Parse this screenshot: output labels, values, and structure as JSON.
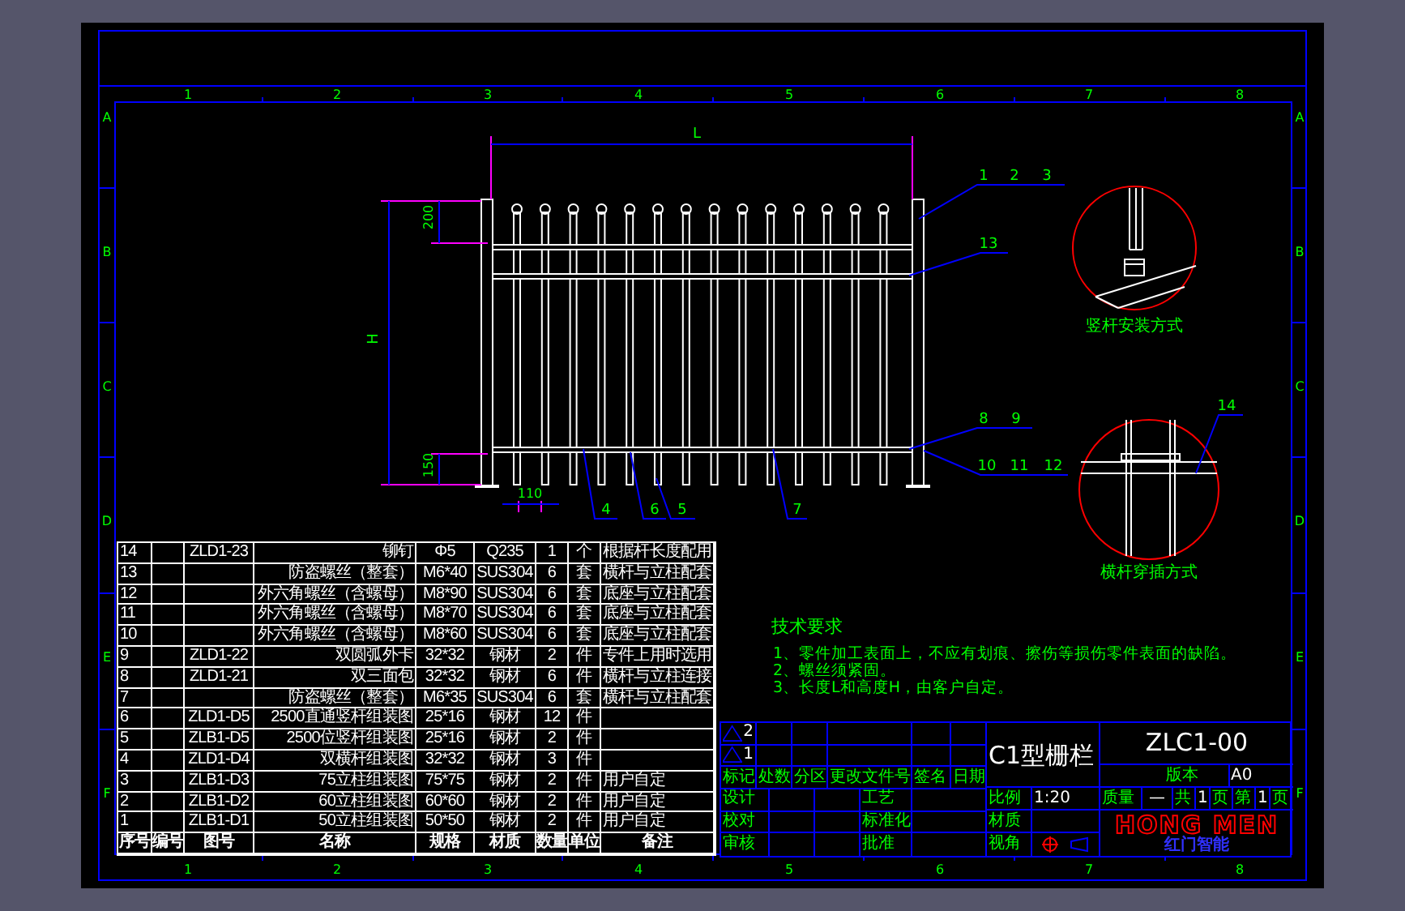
{
  "sheet": {
    "top_ruler": [
      "1",
      "2",
      "3",
      "4",
      "5",
      "6",
      "7",
      "8"
    ],
    "bottom_ruler": [
      "1",
      "2",
      "3",
      "4",
      "5",
      "6",
      "7",
      "8"
    ],
    "left_ruler": [
      "A",
      "B",
      "C",
      "D",
      "E",
      "F"
    ],
    "right_ruler": [
      "A",
      "B",
      "C",
      "D",
      "E",
      "F"
    ]
  },
  "drawing": {
    "dimensions": {
      "length": "L",
      "height": "H",
      "top_gap": "200",
      "bottom_gap": "150",
      "picket_spacing": "110"
    },
    "callouts": [
      {
        "labels": [
          "1",
          "2",
          "3"
        ]
      },
      {
        "labels": [
          "13"
        ]
      },
      {
        "labels": [
          "8",
          "9"
        ]
      },
      {
        "labels": [
          "10",
          "11",
          "12"
        ]
      },
      {
        "labels": [
          "4"
        ]
      },
      {
        "labels": [
          "6"
        ]
      },
      {
        "labels": [
          "5"
        ]
      },
      {
        "labels": [
          "7"
        ]
      }
    ],
    "details": [
      {
        "kind": "post",
        "caption": "竖杆安装方式"
      },
      {
        "kind": "rail",
        "caption": "横杆穿插方式",
        "callout": "14"
      }
    ]
  },
  "requirements": {
    "title": "技术要求",
    "items": [
      "1、零件加工表面上，不应有划痕、擦伤等损伤零件表面的缺陷。",
      "2、螺丝须紧固。",
      "3、长度L和高度H，由客户自定。"
    ]
  },
  "bom": {
    "rows": [
      [
        "14",
        "",
        "ZLD1-23",
        "铆钉",
        "Φ5",
        "Q235",
        "1",
        "个",
        "根据杆长度配用"
      ],
      [
        "13",
        "",
        "",
        "防盗螺丝（整套）",
        "M6*40",
        "SUS304",
        "6",
        "套",
        "横杆与立柱配套"
      ],
      [
        "12",
        "",
        "",
        "外六角螺丝（含螺母）",
        "M8*90",
        "SUS304",
        "6",
        "套",
        "底座与立柱配套"
      ],
      [
        "11",
        "",
        "",
        "外六角螺丝（含螺母）",
        "M8*70",
        "SUS304",
        "6",
        "套",
        "底座与立柱配套"
      ],
      [
        "10",
        "",
        "",
        "外六角螺丝（含螺母）",
        "M8*60",
        "SUS304",
        "6",
        "套",
        "底座与立柱配套"
      ],
      [
        "9",
        "",
        "ZLD1-22",
        "双圆弧外卡",
        "32*32",
        "钢材",
        "2",
        "件",
        "专件上用时选用"
      ],
      [
        "8",
        "",
        "ZLD1-21",
        "双三面包",
        "32*32",
        "钢材",
        "6",
        "件",
        "横杆与立柱连接"
      ],
      [
        "7",
        "",
        "",
        "防盗螺丝（整套）",
        "M6*35",
        "SUS304",
        "6",
        "套",
        "横杆与立柱配套"
      ],
      [
        "6",
        "",
        "ZLD1-D5",
        "2500直通竖杆组装图",
        "25*16",
        "钢材",
        "12",
        "件",
        ""
      ],
      [
        "5",
        "",
        "ZLB1-D5",
        "2500位竖杆组装图",
        "25*16",
        "钢材",
        "2",
        "件",
        ""
      ],
      [
        "4",
        "",
        "ZLD1-D4",
        "双横杆组装图",
        "32*32",
        "钢材",
        "3",
        "件",
        ""
      ],
      [
        "3",
        "",
        "ZLB1-D3",
        "75立柱组装图",
        "75*75",
        "钢材",
        "2",
        "件",
        "用户自定"
      ],
      [
        "2",
        "",
        "ZLB1-D2",
        "60立柱组装图",
        "60*60",
        "钢材",
        "2",
        "件",
        "用户自定"
      ],
      [
        "1",
        "",
        "ZLB1-D1",
        "50立柱组装图",
        "50*50",
        "钢材",
        "2",
        "件",
        "用户自定"
      ]
    ],
    "footer_labels": [
      "序号",
      "编号",
      "图号",
      "名称",
      "规格",
      "材质",
      "数量",
      "单位",
      "备注"
    ]
  },
  "title_block": {
    "revisions": [
      "2",
      "1"
    ],
    "revision_headers": [
      "标记",
      "处数",
      "分区",
      "更改文件号",
      "签名",
      "日期"
    ],
    "approvals": [
      {
        "left": "设计",
        "right": "工艺"
      },
      {
        "left": "校对",
        "right": "标准化"
      },
      {
        "left": "审核",
        "right": "批准"
      }
    ],
    "title": "C1型栅栏",
    "drawing_number": "ZLC1-00",
    "version_label": "版本",
    "version": "A0",
    "scale_label": "比例",
    "scale": "1:20",
    "mass_label": "质量",
    "mass": "—",
    "total_label": "共",
    "total": "1",
    "total_unit": "页",
    "sheet_label": "第",
    "sheet": "1",
    "sheet_unit": "页",
    "material_label": "材质",
    "view_label": "视角",
    "logo": {
      "name": "HONG MEN",
      "tagline": "红门智能"
    }
  }
}
